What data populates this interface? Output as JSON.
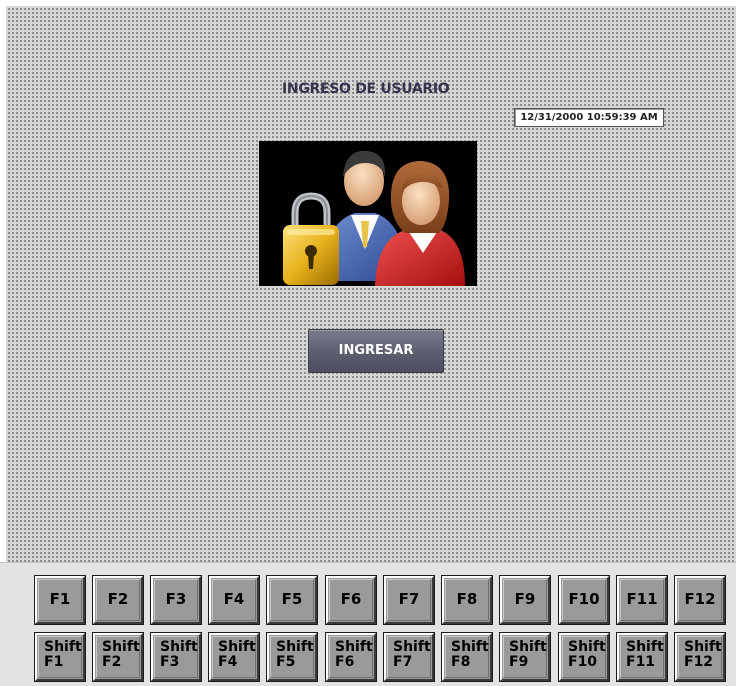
{
  "screen": {
    "title": "INGRESO DE USUARIO",
    "datetime": "12/31/2000 10:59:39 AM",
    "image_icon": "users-lock-icon",
    "login_button_label": "INGRESAR"
  },
  "function_keys": [
    {
      "label": "F1"
    },
    {
      "label": "F2"
    },
    {
      "label": "F3"
    },
    {
      "label": "F4"
    },
    {
      "label": "F5"
    },
    {
      "label": "F6"
    },
    {
      "label": "F7"
    },
    {
      "label": "F8"
    },
    {
      "label": "F9"
    },
    {
      "label": "F10"
    },
    {
      "label": "F11"
    },
    {
      "label": "F12"
    }
  ],
  "shift_keys": [
    {
      "line1": "Shift",
      "line2": "F1"
    },
    {
      "line1": "Shift",
      "line2": "F2"
    },
    {
      "line1": "Shift",
      "line2": "F3"
    },
    {
      "line1": "Shift",
      "line2": "F4"
    },
    {
      "line1": "Shift",
      "line2": "F5"
    },
    {
      "line1": "Shift",
      "line2": "F6"
    },
    {
      "line1": "Shift",
      "line2": "F7"
    },
    {
      "line1": "Shift",
      "line2": "F8"
    },
    {
      "line1": "Shift",
      "line2": "F9"
    },
    {
      "line1": "Shift",
      "line2": "F10"
    },
    {
      "line1": "Shift",
      "line2": "F11"
    },
    {
      "line1": "Shift",
      "line2": "F12"
    }
  ],
  "colors": {
    "screen_bg": "#d6d6d6",
    "button_bg": "#5c5e70",
    "key_bg": "#9a9a9a"
  }
}
